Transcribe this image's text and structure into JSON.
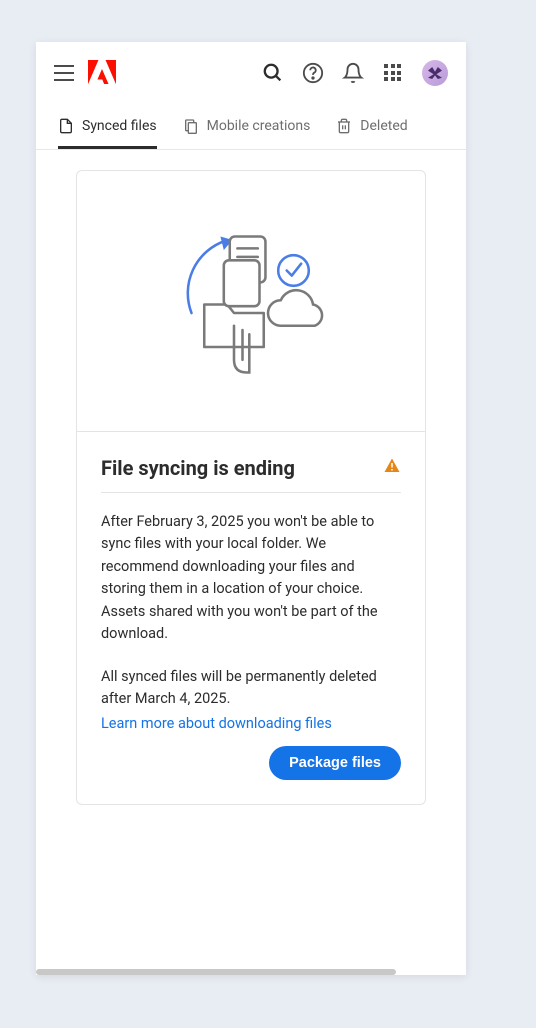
{
  "tabs": {
    "synced": "Synced files",
    "mobile": "Mobile creations",
    "deleted": "Deleted"
  },
  "card": {
    "title": "File syncing is ending",
    "paragraph1": "After February 3, 2025 you won't be able to sync files with your local folder. We recommend downloading your files and storing them in a location of your choice. Assets shared with you won't be part of the download.",
    "paragraph2": "All synced files will be permanently deleted after March 4, 2025.",
    "link": "Learn more about downloading files",
    "button": "Package files"
  }
}
